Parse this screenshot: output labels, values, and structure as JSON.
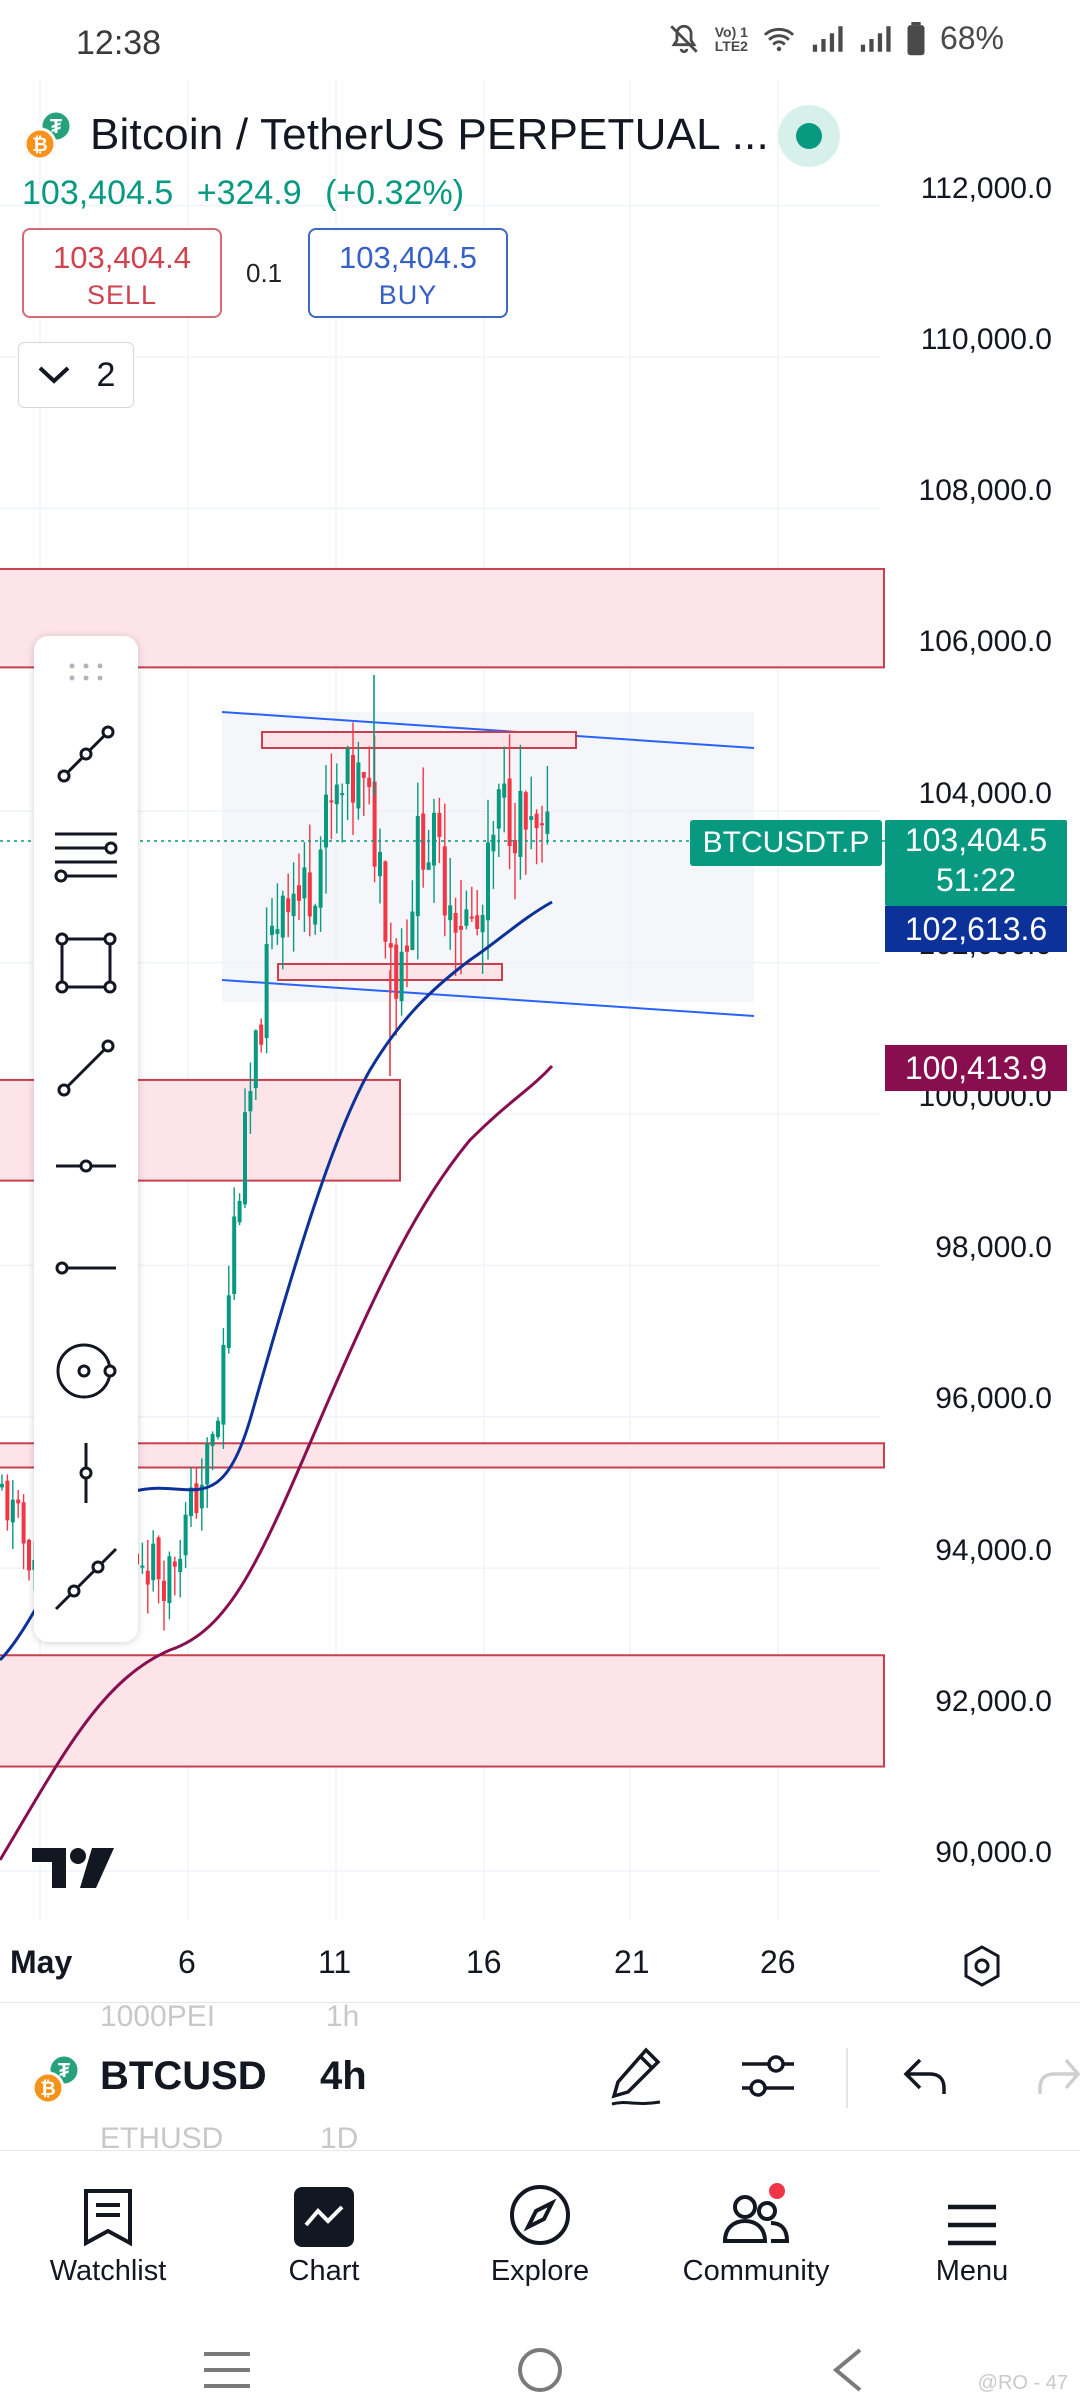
{
  "status_bar": {
    "time": "12:38",
    "network_label_top": "Vo) 1",
    "network_label_bottom": "LTE2",
    "battery": "68%"
  },
  "header": {
    "symbol_title": "Bitcoin / TetherUS PERPETUAL ...",
    "price": "103,404.5",
    "change": "+324.9",
    "change_pct": "(+0.32%)",
    "sell_price": "103,404.4",
    "sell_label": "SELL",
    "spread": "0.1",
    "buy_price": "103,404.5",
    "buy_label": "BUY",
    "indicator_count": "2"
  },
  "price_axis": {
    "labels": [
      "112,000.0",
      "110,000.0",
      "108,000.0",
      "106,000.0",
      "104,000.0",
      "102,000.0",
      "100,000.0",
      "98,000.0",
      "96,000.0",
      "94,000.0",
      "92,000.0",
      "90,000.0"
    ],
    "symbol_tag": "BTCUSDT.P",
    "last_price": "103,404.5",
    "countdown": "51:22",
    "ma_fast": "102,613.6",
    "ma_slow": "100,413.9"
  },
  "date_axis": {
    "labels": [
      "May",
      "6",
      "11",
      "16",
      "21",
      "26"
    ]
  },
  "symbol_bar": {
    "symbol": "BTCUSD",
    "interval": "4h",
    "ghost_symbol_above": "1000PEI",
    "ghost_symbol_below": "ETHUSD",
    "ghost_interval_above": "1h",
    "ghost_interval_below": "1D"
  },
  "bottom_nav": {
    "items": [
      {
        "label": "Watchlist",
        "icon": "watchlist-icon"
      },
      {
        "label": "Chart",
        "icon": "chart-icon"
      },
      {
        "label": "Explore",
        "icon": "compass-icon"
      },
      {
        "label": "Community",
        "icon": "community-icon"
      },
      {
        "label": "Menu",
        "icon": "menu-icon"
      }
    ]
  },
  "watermark": "@RO - 47",
  "colors": {
    "bull": "#089981",
    "bear": "#f23645",
    "zone_fill": "#fde4e8",
    "zone_border": "#c8404e",
    "channel": "#2962ff",
    "ma_fast": "#0c3299",
    "ma_slow": "#880e4f"
  }
}
